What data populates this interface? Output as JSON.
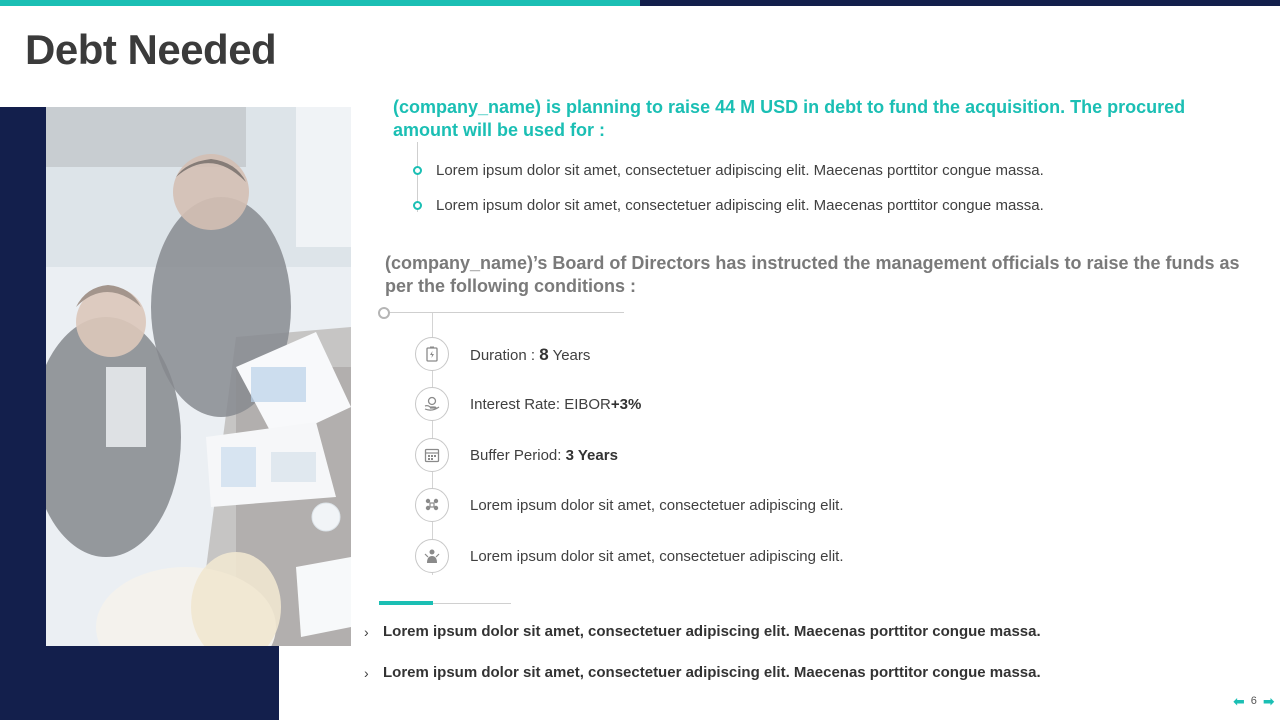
{
  "slide": {
    "title": "Debt Needed",
    "intro": "(company_name) is planning to raise 44 M USD in debt to fund the acquisition. The procured amount will be used for :",
    "bullets": [
      "Lorem ipsum dolor sit amet, consectetuer adipiscing elit. Maecenas porttitor congue massa.",
      "Lorem ipsum dolor sit amet, consectetuer adipiscing elit. Maecenas porttitor congue massa."
    ],
    "board_text": "(company_name)’s Board of Directors has instructed the management officials to raise the funds as per the following conditions :",
    "conditions": [
      {
        "icon": "battery-icon",
        "label": "Duration : ",
        "value": "8",
        "suffix": " Years"
      },
      {
        "icon": "hand-coin-icon",
        "label": "Interest Rate: EIBOR",
        "value": "+3%"
      },
      {
        "icon": "calendar-icon",
        "label": "Buffer Period: ",
        "value": "3 Years"
      },
      {
        "icon": "team-icon",
        "label": "Lorem ipsum dolor sit amet, consectetuer adipiscing elit."
      },
      {
        "icon": "presenter-icon",
        "label": "Lorem ipsum dolor sit amet, consectetuer adipiscing elit."
      }
    ],
    "bottom_points": [
      "Lorem ipsum dolor sit amet, consectetuer adipiscing elit. Maecenas porttitor congue massa.",
      "Lorem ipsum dolor sit amet, consectetuer adipiscing elit. Maecenas porttitor congue massa."
    ],
    "page_number": "6",
    "nav": {
      "prev_icon": "arrow-left-icon",
      "next_icon": "arrow-right-icon"
    }
  },
  "colors": {
    "teal": "#1bbfb4",
    "navy": "#131f4c",
    "title": "#3b3b3b",
    "board_text": "#7a7a7a"
  }
}
